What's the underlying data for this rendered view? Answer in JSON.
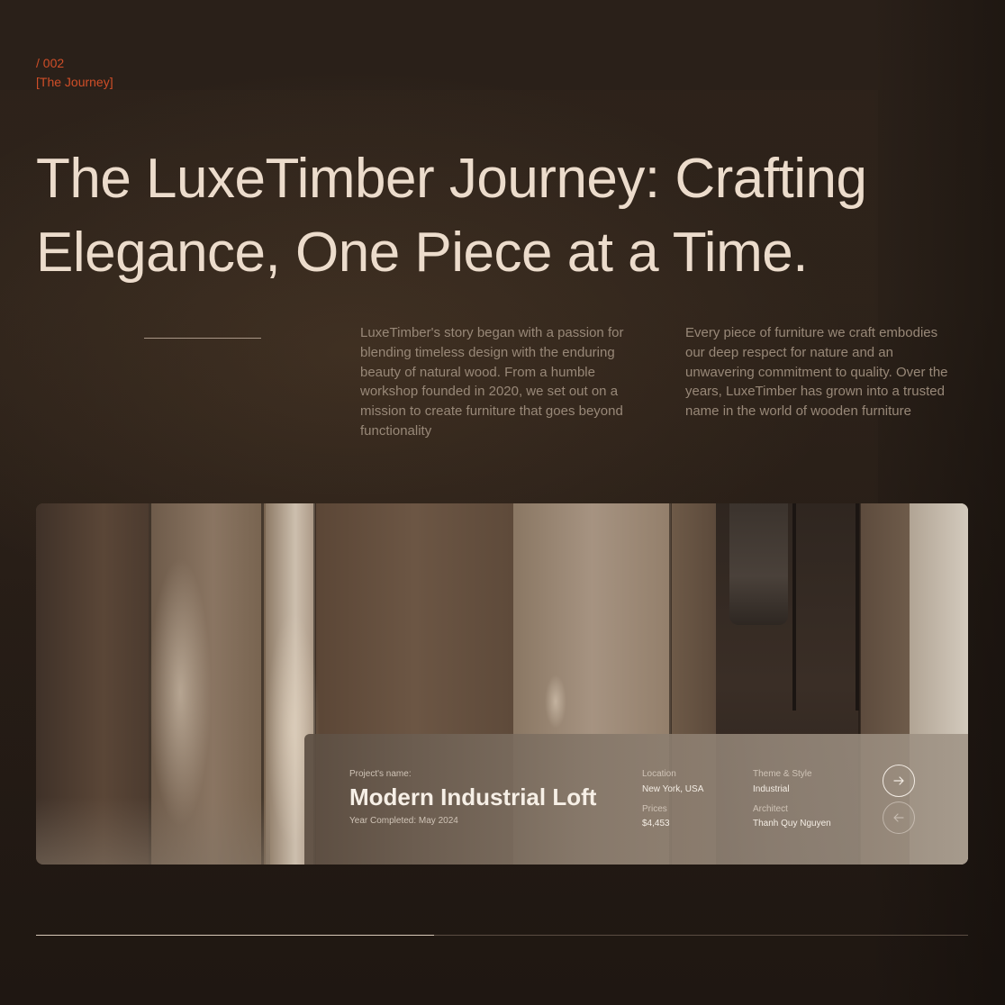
{
  "section": {
    "number": "/ 002",
    "tag": "[The Journey]"
  },
  "headline": {
    "line1": "The LuxeTimber Journey: Crafting",
    "line2": "Elegance, One Piece at a Time."
  },
  "intro": {
    "paragraph1": "LuxeTimber's story began with a passion for blending timeless design with the enduring beauty of natural wood. From a humble workshop founded in 2020, we set out on a mission to create furniture that goes beyond functionality",
    "paragraph2": "Every piece of furniture we craft embodies our deep respect for nature and an unwavering commitment to quality. Over the years, LuxeTimber has grown into a trusted name in the world of wooden furniture"
  },
  "project": {
    "name_label": "Project's name:",
    "name": "Modern Industrial Loft",
    "year_completed": "Year Completed: May 2024",
    "location_label": "Location",
    "location": "New York, USA",
    "prices_label": "Prices",
    "price": "$4,453",
    "theme_label": "Theme & Style",
    "theme": "Industrial",
    "architect_label": "Architect",
    "architect": "Thanh Quy Nguyen"
  },
  "icons": {
    "next": "arrow-right-icon",
    "prev": "arrow-left-icon"
  },
  "slider": {
    "progress": 0.427
  },
  "colors": {
    "accent": "#d04e28",
    "headline": "#ecdccc",
    "body_text": "#988878",
    "background": "#221a14"
  }
}
